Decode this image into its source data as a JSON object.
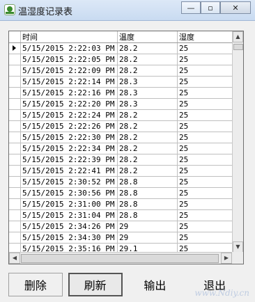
{
  "window": {
    "title": "温湿度记录表",
    "controls": {
      "minimize": "—",
      "maximize": "▫",
      "close": "✕"
    }
  },
  "grid": {
    "columns": [
      "时间",
      "温度",
      "湿度"
    ],
    "selected_row_index": 0,
    "rows": [
      [
        "5/15/2015 2:22:03 PM",
        "28.2",
        "25"
      ],
      [
        "5/15/2015 2:22:05 PM",
        "28.2",
        "25"
      ],
      [
        "5/15/2015 2:22:09 PM",
        "28.2",
        "25"
      ],
      [
        "5/15/2015 2:22:14 PM",
        "28.3",
        "25"
      ],
      [
        "5/15/2015 2:22:16 PM",
        "28.3",
        "25"
      ],
      [
        "5/15/2015 2:22:20 PM",
        "28.3",
        "25"
      ],
      [
        "5/15/2015 2:22:24 PM",
        "28.2",
        "25"
      ],
      [
        "5/15/2015 2:22:26 PM",
        "28.2",
        "25"
      ],
      [
        "5/15/2015 2:22:30 PM",
        "28.2",
        "25"
      ],
      [
        "5/15/2015 2:22:34 PM",
        "28.2",
        "25"
      ],
      [
        "5/15/2015 2:22:39 PM",
        "28.2",
        "25"
      ],
      [
        "5/15/2015 2:22:41 PM",
        "28.2",
        "25"
      ],
      [
        "5/15/2015 2:30:52 PM",
        "28.8",
        "25"
      ],
      [
        "5/15/2015 2:30:56 PM",
        "28.8",
        "25"
      ],
      [
        "5/15/2015 2:31:00 PM",
        "28.8",
        "25"
      ],
      [
        "5/15/2015 2:31:04 PM",
        "28.8",
        "25"
      ],
      [
        "5/15/2015 2:34:26 PM",
        "29",
        "25"
      ],
      [
        "5/15/2015 2:34:30 PM",
        "29",
        "25"
      ],
      [
        "5/15/2015 2:35:16 PM",
        "29.1",
        "25"
      ]
    ]
  },
  "buttons": {
    "delete": "删除",
    "refresh": "刷新",
    "export": "输出",
    "exit": "退出"
  },
  "watermark": "www.Ndiy.cn"
}
